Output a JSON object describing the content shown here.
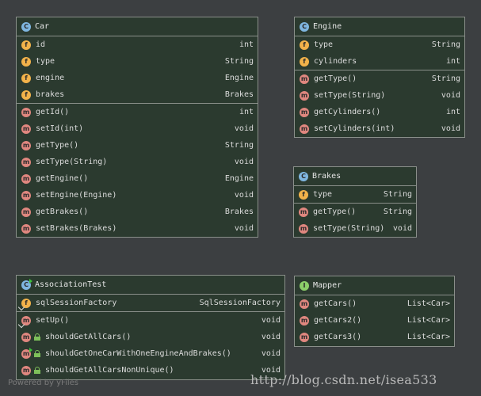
{
  "classes": {
    "car": {
      "name": "Car",
      "fields": [
        {
          "name": "id",
          "type": "int"
        },
        {
          "name": "type",
          "type": "String"
        },
        {
          "name": "engine",
          "type": "Engine"
        },
        {
          "name": "brakes",
          "type": "Brakes"
        }
      ],
      "methods": [
        {
          "name": "getId()",
          "type": "int"
        },
        {
          "name": "setId(int)",
          "type": "void"
        },
        {
          "name": "getType()",
          "type": "String"
        },
        {
          "name": "setType(String)",
          "type": "void"
        },
        {
          "name": "getEngine()",
          "type": "Engine"
        },
        {
          "name": "setEngine(Engine)",
          "type": "void"
        },
        {
          "name": "getBrakes()",
          "type": "Brakes"
        },
        {
          "name": "setBrakes(Brakes)",
          "type": "void"
        }
      ]
    },
    "engine": {
      "name": "Engine",
      "fields": [
        {
          "name": "type",
          "type": "String"
        },
        {
          "name": "cylinders",
          "type": "int"
        }
      ],
      "methods": [
        {
          "name": "getType()",
          "type": "String"
        },
        {
          "name": "setType(String)",
          "type": "void"
        },
        {
          "name": "getCylinders()",
          "type": "int"
        },
        {
          "name": "setCylinders(int)",
          "type": "void"
        }
      ]
    },
    "brakes": {
      "name": "Brakes",
      "fields": [
        {
          "name": "type",
          "type": "String"
        }
      ],
      "methods": [
        {
          "name": "getType()",
          "type": "String"
        },
        {
          "name": "setType(String)",
          "type": "void"
        }
      ]
    },
    "association_test": {
      "name": "AssociationTest",
      "fields": [
        {
          "name": "sqlSessionFactory",
          "type": "SqlSessionFactory"
        }
      ],
      "methods": [
        {
          "name": "setUp()",
          "type": "void"
        },
        {
          "name": "shouldGetAllCars()",
          "type": "void"
        },
        {
          "name": "shouldGetOneCarWithOneEngineAndBrakes()",
          "type": "void"
        },
        {
          "name": "shouldGetAllCarsNonUnique()",
          "type": "void"
        }
      ]
    },
    "mapper": {
      "name": "Mapper",
      "methods": [
        {
          "name": "getCars()",
          "type": "List<Car>"
        },
        {
          "name": "getCars2()",
          "type": "List<Car>"
        },
        {
          "name": "getCars3()",
          "type": "List<Car>"
        }
      ]
    }
  },
  "badges": {
    "class": "C",
    "field": "f",
    "method": "m",
    "interface": "I"
  },
  "watermark": {
    "powered_by": "Powered by yFiles",
    "url": "http://blog.csdn.net/isea533"
  }
}
